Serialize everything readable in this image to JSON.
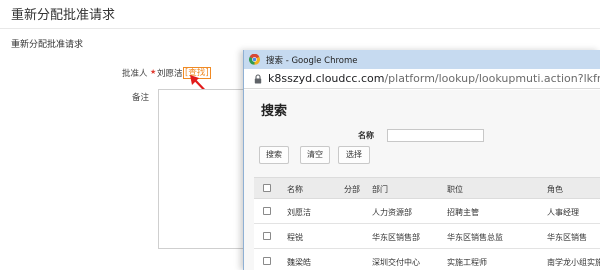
{
  "page": {
    "title": "重新分配批准请求",
    "section_title": "重新分配批准请求"
  },
  "form": {
    "approver_label": "批准人",
    "required_mark": "★",
    "approver_value": "刘愿洁",
    "lookup_label": "[查找]",
    "remark_label": "备注"
  },
  "popup": {
    "window_title": "搜索 - Google Chrome",
    "url_domain": "k8sszyd.cloudcc.com",
    "url_path": "/platform/lookup/lookupmuti.action?lkfm=editPage&",
    "heading": "搜索",
    "name_label": "名称",
    "name_value": "",
    "buttons": {
      "search": "搜索",
      "clear": "清空",
      "select": "选择"
    },
    "table": {
      "columns": [
        "名称",
        "分部",
        "部门",
        "职位",
        "角色"
      ],
      "rows": [
        {
          "name": "刘愿洁",
          "division": "",
          "department": "人力资源部",
          "position": "招聘主管",
          "role": "人事经理"
        },
        {
          "name": "程锐",
          "division": "",
          "department": "华东区销售部",
          "position": "华东区销售总监",
          "role": "华东区销售"
        },
        {
          "name": "魏梁皓",
          "division": "",
          "department": "深圳交付中心",
          "position": "实施工程师",
          "role": "南学龙小组实施"
        }
      ]
    }
  },
  "colors": {
    "lookup_accent": "#f08a24",
    "required_star": "#e03c31",
    "arrow": "#e21b1b",
    "titlebar": "#c6daf0"
  },
  "icons": [
    "chrome-icon",
    "lock-icon",
    "arrow-annotation"
  ]
}
